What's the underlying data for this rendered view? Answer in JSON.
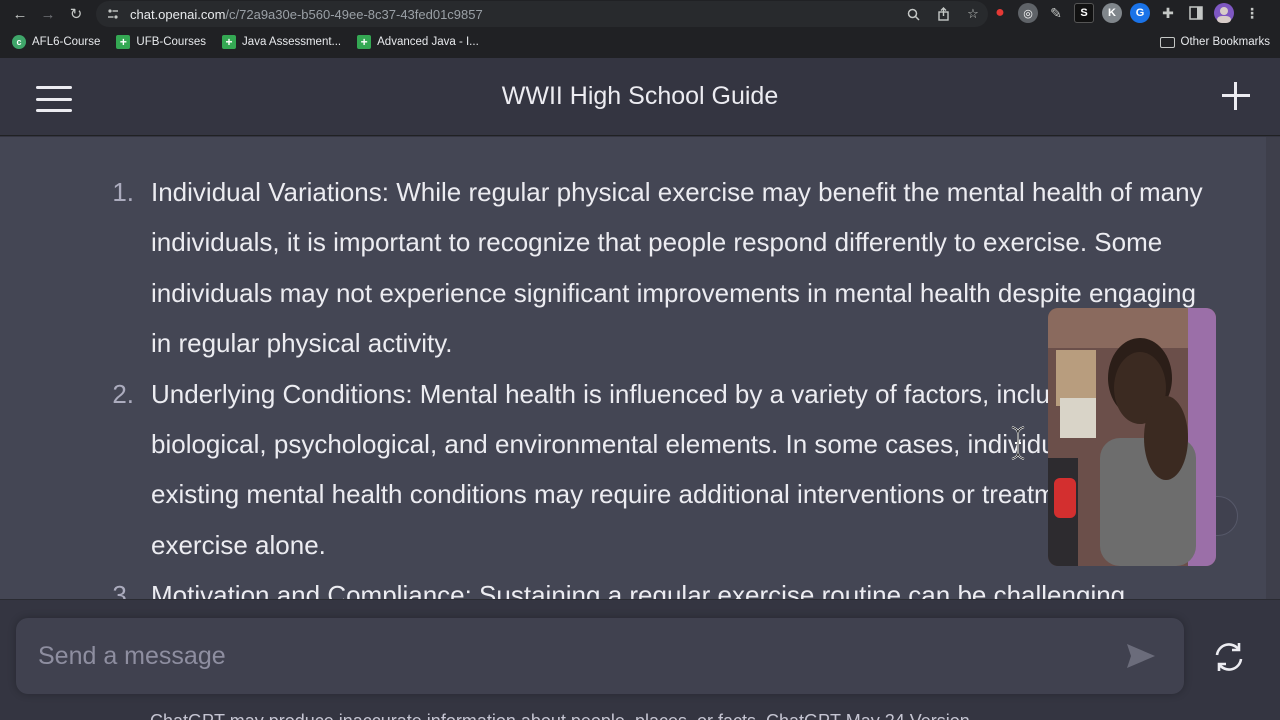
{
  "browser": {
    "url_host": "chat.openai.com",
    "url_path": "/c/72a9a30e-b560-49ee-8c37-43fed01c9857",
    "bookmarks": [
      {
        "label": "AFL6-Course",
        "color": "#3fa66a",
        "icon": "c-icon"
      },
      {
        "label": "UFB-Courses",
        "color": "#34a853",
        "icon": "plus-icon"
      },
      {
        "label": "Java Assessment...",
        "color": "#34a853",
        "icon": "plus-icon"
      },
      {
        "label": "Advanced Java - I...",
        "color": "#34a853",
        "icon": "plus-icon"
      }
    ],
    "other_bookmarks": "Other Bookmarks",
    "extensions": [
      {
        "name": "red-drop-icon",
        "color": "#e53935",
        "glyph": "●"
      },
      {
        "name": "swirl-icon",
        "color": "#5f6368",
        "glyph": "◎"
      },
      {
        "name": "pen-icon",
        "color": "#202124",
        "glyph": "✎"
      },
      {
        "name": "s-extension-icon",
        "color": "#111111",
        "glyph": "S"
      },
      {
        "name": "k-extension-icon",
        "color": "#80868b",
        "glyph": "K"
      },
      {
        "name": "g-extension-icon",
        "color": "#1a73e8",
        "glyph": "G"
      }
    ]
  },
  "app": {
    "title": "WWII High School Guide"
  },
  "list_items": [
    {
      "number": "1.",
      "text": "Individual Variations: While regular physical exercise may benefit the mental health of many individuals, it is important to recognize that people respond differently to exercise. Some individuals may not experience significant improvements in mental health despite engaging in regular physical activity."
    },
    {
      "number": "2.",
      "text": "Underlying Conditions: Mental health is influenced by a variety of factors, including biological, psychological, and environmental elements. In some cases, individuals with pre-existing mental health conditions may require additional interventions or treatments beyond exercise alone."
    },
    {
      "number": "3.",
      "text": "Motivation and Compliance: Sustaining a regular exercise routine can be challenging"
    }
  ],
  "composer": {
    "placeholder": "Send a message"
  },
  "disclaimer": "ChatGPT may produce inaccurate information about people, places, or facts. ChatGPT May 24 Version"
}
